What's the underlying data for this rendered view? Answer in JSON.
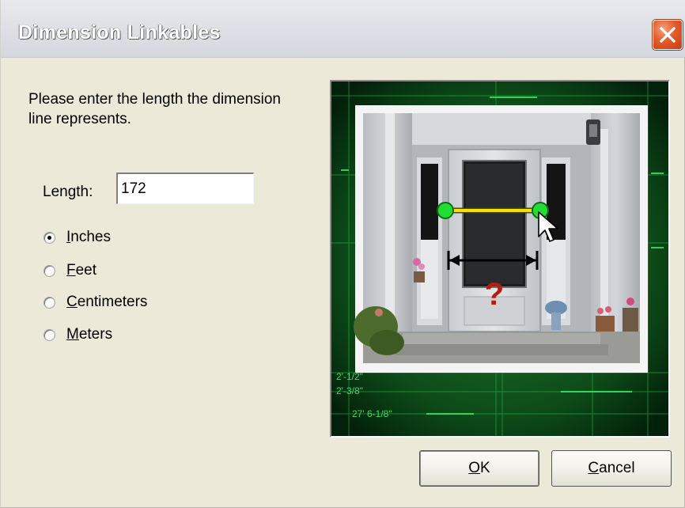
{
  "window": {
    "title": "Dimension Linkables"
  },
  "prompt": {
    "text": "Please enter the length the dimension line represents."
  },
  "length": {
    "label": "Length:",
    "value": "172"
  },
  "units": {
    "options": [
      {
        "mnemonic": "I",
        "rest": "nches",
        "checked": true
      },
      {
        "mnemonic": "F",
        "rest": "eet",
        "checked": false
      },
      {
        "mnemonic": "C",
        "rest": "entimeters",
        "checked": false
      },
      {
        "mnemonic": "M",
        "rest": "eters",
        "checked": false
      }
    ]
  },
  "preview": {
    "question_mark": "?",
    "blueprint_labels": [
      "2'-1/2\"",
      "2'-3/8\"",
      "27' 6-1/8\""
    ]
  },
  "buttons": {
    "ok": {
      "mnemonic": "O",
      "rest": "K"
    },
    "cancel": {
      "mnemonic": "C",
      "rest": "ancel"
    }
  },
  "colors": {
    "dialog_bg": "#ece9d8",
    "close_red": "#e25c2a",
    "blueprint_green": "#1ec94a",
    "marker_green": "#22dd33",
    "dimension_yellow": "#f5e200"
  }
}
